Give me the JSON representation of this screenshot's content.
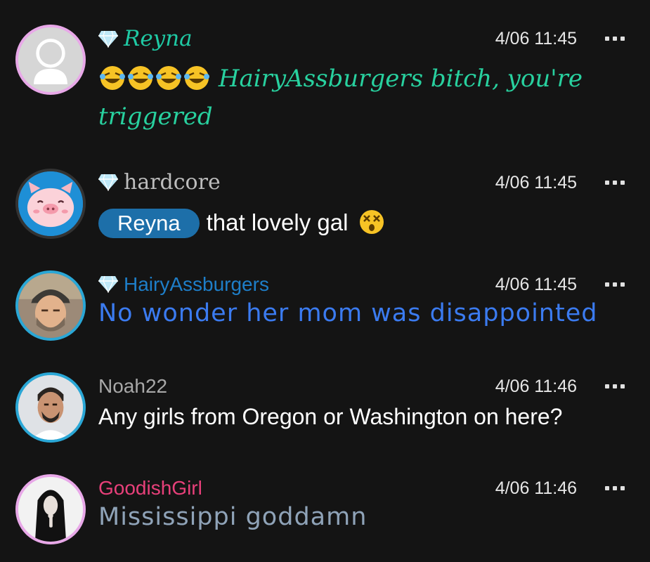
{
  "messages": [
    {
      "username": "Reyna",
      "name_color": "#1fc9a4",
      "verified": true,
      "timestamp": "4/06 11:45",
      "text": "HairyAssburgers bitch, you're triggered",
      "text_color": "#28d19f",
      "emoji_prefix": [
        "rolling-on-floor-laughing",
        "rolling-on-floor-laughing",
        "rolling-on-floor-laughing",
        "rolling-on-floor-laughing"
      ],
      "avatar": "default-person-avatar",
      "avatar_ring": "#e8a8e8"
    },
    {
      "username": "hardcore",
      "name_color": "#bdbdbd",
      "verified": true,
      "timestamp": "4/06 11:45",
      "mention": "Reyna",
      "text": "that lovely gal",
      "text_color": "#ffffff",
      "emoji_suffix": "dizzy-face",
      "avatar": "pig-avatar",
      "avatar_ring": "#333333"
    },
    {
      "username": "HairyAssburgers",
      "name_color": "#1e7ec8",
      "verified": true,
      "timestamp": "4/06 11:45",
      "text": "No wonder her mom was disappointed",
      "text_color": "#3b7bf0",
      "avatar": "man-with-cap-photo",
      "avatar_ring": "#2aa7d6"
    },
    {
      "username": "Noah22",
      "name_color": "#a8a8a8",
      "verified": false,
      "timestamp": "4/06 11:46",
      "text": "Any girls from Oregon or Washington on here?",
      "text_color": "#ffffff",
      "avatar": "man-selfie-photo",
      "avatar_ring": "#2aa7d6"
    },
    {
      "username": "GoodishGirl",
      "name_color": "#e8407a",
      "verified": false,
      "timestamp": "4/06 11:46",
      "text": "Mississippi goddamn",
      "text_color": "#8fa3b8",
      "avatar": "nun-silhouette-photo",
      "avatar_ring": "#e8a8e8"
    }
  ],
  "icons": {
    "verified": "diamond-icon",
    "menu": "more-options-icon"
  }
}
